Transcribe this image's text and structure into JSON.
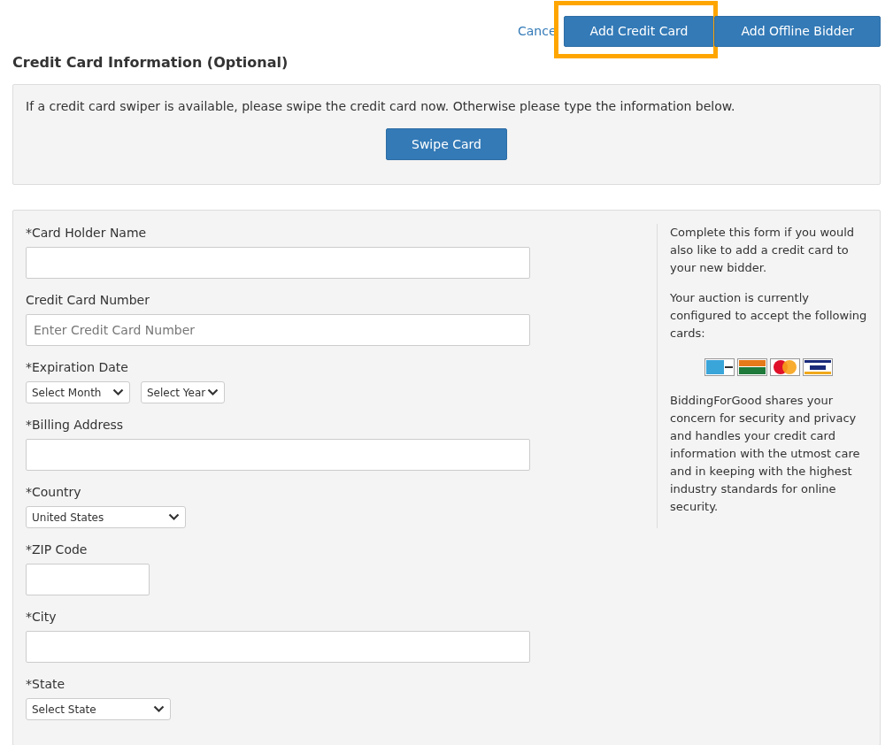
{
  "header_actions": {
    "cancel_link": "Cance",
    "buttons": [
      {
        "label": "Add Credit Card",
        "highlighted": true
      },
      {
        "label": "Add Offline Bidder",
        "highlighted": false
      }
    ]
  },
  "section_title": "Credit Card Information (Optional)",
  "swipe_panel": {
    "text": "If a credit card swiper is available, please swipe the credit card now. Otherwise please type the information below.",
    "button": "Swipe Card"
  },
  "form": {
    "fields": [
      {
        "kind": "text",
        "label": "*Card Holder Name"
      },
      {
        "kind": "text",
        "label": "Credit Card Number",
        "placeholder": "Enter Credit Card Number"
      },
      {
        "kind": "selects",
        "label": "*Expiration Date",
        "selects": [
          {
            "value": "Select Month"
          },
          {
            "value": "Select Year"
          }
        ]
      },
      {
        "kind": "text",
        "label": "*Billing Address"
      },
      {
        "kind": "selects",
        "label": "*Country",
        "selects": [
          {
            "value": "United States"
          }
        ]
      },
      {
        "kind": "short_text",
        "label": "*ZIP Code"
      },
      {
        "kind": "text",
        "label": "*City"
      },
      {
        "kind": "selects",
        "label": "*State",
        "selects": [
          {
            "value": "Select State"
          }
        ]
      }
    ]
  },
  "info": {
    "items": [
      {
        "kind": "paragraph",
        "text": "Complete this form if you would also like to add a credit card to your new bidder."
      },
      {
        "kind": "paragraph",
        "text": "Your auction is currently configured to accept the following cards:"
      },
      {
        "kind": "card_logos"
      },
      {
        "kind": "paragraph",
        "text": "BiddingForGood shares your concern for security and privacy and handles your credit card information with the utmost care and in keeping with the highest industry standards for online security."
      }
    ]
  }
}
